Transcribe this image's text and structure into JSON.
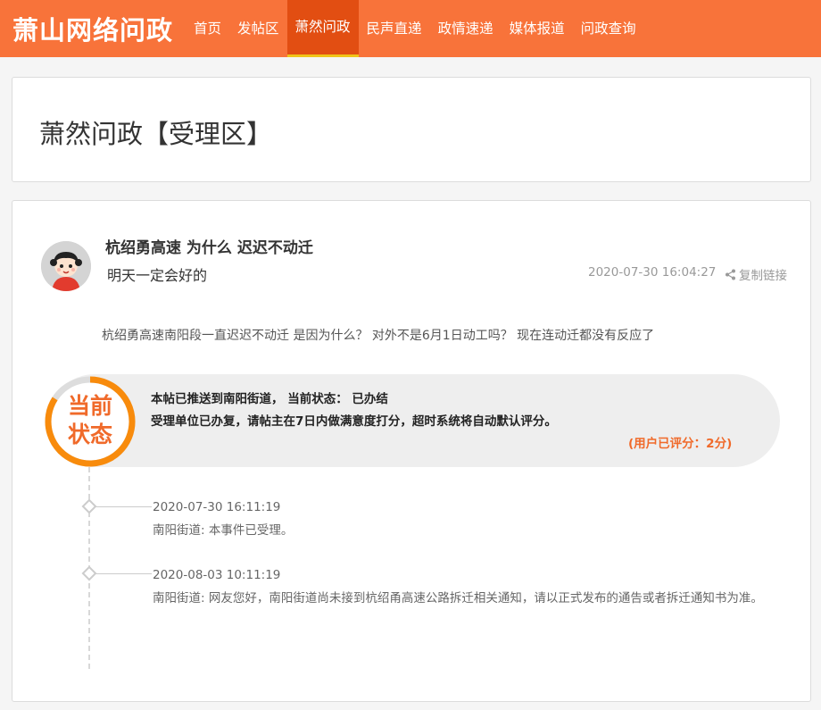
{
  "header": {
    "logo": "萧山网络问政",
    "nav": [
      {
        "label": "首页",
        "active": false
      },
      {
        "label": "发帖区",
        "active": false
      },
      {
        "label": "萧然问政",
        "active": true
      },
      {
        "label": "民声直递",
        "active": false
      },
      {
        "label": "政情速递",
        "active": false
      },
      {
        "label": "媒体报道",
        "active": false
      },
      {
        "label": "问政查询",
        "active": false
      }
    ]
  },
  "page": {
    "title": "萧然问政【受理区】"
  },
  "post": {
    "title": "杭绍勇高速 为什么 迟迟不动迁",
    "subtitle": "明天一定会好的",
    "time": "2020-07-30 16:04:27",
    "share_label": "复制链接",
    "body": "杭绍勇高速南阳段一直迟迟不动迁 是因为什么？ 对外不是6月1日动工吗？ 现在连动迁都没有反应了"
  },
  "status": {
    "ring_label_line1": "当前",
    "ring_label_line2": "状态",
    "line1": "本帖已推送到南阳街道， 当前状态： 已办结",
    "line2": "受理单位已办复，请帖主在7日内做满意度打分，超时系统将自动默认评分。",
    "score": "(用户已评分：2分)",
    "accent_color": "#f06a2a"
  },
  "timeline": [
    {
      "time": "2020-07-30 16:11:19",
      "text": "南阳街道: 本事件已受理。"
    },
    {
      "time": "2020-08-03 10:11:19",
      "text": "南阳街道: 网友您好，南阳街道尚未接到杭绍甬高速公路拆迁相关通知，请以正式发布的通告或者拆迁通知书为准。"
    }
  ],
  "colors": {
    "header_bg": "#f8733a",
    "nav_active_bg": "#e24e12"
  }
}
